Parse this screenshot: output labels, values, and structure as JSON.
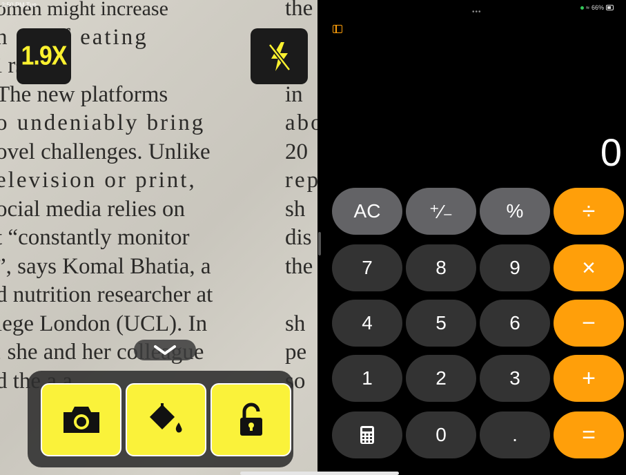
{
  "status_bar": {
    "time": "2:50 PM Tue",
    "dots": "•••",
    "battery": "66%"
  },
  "magnifier": {
    "zoom_label": "1.9X",
    "text_left": [
      "omen might increase",
      "h  sk  of  eating",
      "i        rs.",
      "   The new platforms",
      "o undeniably bring",
      "ovel challenges. Unlike",
      "elevision or print,",
      "ocial media relies on",
      "t “constantly monitor",
      "”, says Komal Bhatia, a",
      "d nutrition researcher at",
      "lege London (UCL). In",
      ", she and her colleague",
      "d the    a      a    "
    ],
    "text_right": [
      "the",
      "",
      "re",
      "in",
      "abo",
      "20",
      "rep",
      "sh",
      "dis",
      "the",
      "",
      "sh",
      "pe",
      "so"
    ]
  },
  "calculator": {
    "display": "0",
    "keys": [
      {
        "id": "ac",
        "label": "AC",
        "type": "fn"
      },
      {
        "id": "sign",
        "label": "⁺⁄₋",
        "type": "fn"
      },
      {
        "id": "percent",
        "label": "%",
        "type": "fn"
      },
      {
        "id": "divide",
        "label": "÷",
        "type": "op"
      },
      {
        "id": "seven",
        "label": "7",
        "type": "num"
      },
      {
        "id": "eight",
        "label": "8",
        "type": "num"
      },
      {
        "id": "nine",
        "label": "9",
        "type": "num"
      },
      {
        "id": "multiply",
        "label": "×",
        "type": "op"
      },
      {
        "id": "four",
        "label": "4",
        "type": "num"
      },
      {
        "id": "five",
        "label": "5",
        "type": "num"
      },
      {
        "id": "six",
        "label": "6",
        "type": "num"
      },
      {
        "id": "minus",
        "label": "−",
        "type": "op"
      },
      {
        "id": "one",
        "label": "1",
        "type": "num"
      },
      {
        "id": "two",
        "label": "2",
        "type": "num"
      },
      {
        "id": "three",
        "label": "3",
        "type": "num"
      },
      {
        "id": "plus",
        "label": "+",
        "type": "op"
      },
      {
        "id": "calc-icon",
        "label": "",
        "type": "num"
      },
      {
        "id": "zero",
        "label": "0",
        "type": "num"
      },
      {
        "id": "decimal",
        "label": ".",
        "type": "num"
      },
      {
        "id": "equals",
        "label": "=",
        "type": "op"
      }
    ],
    "accent_color": "#ff9f0a"
  }
}
